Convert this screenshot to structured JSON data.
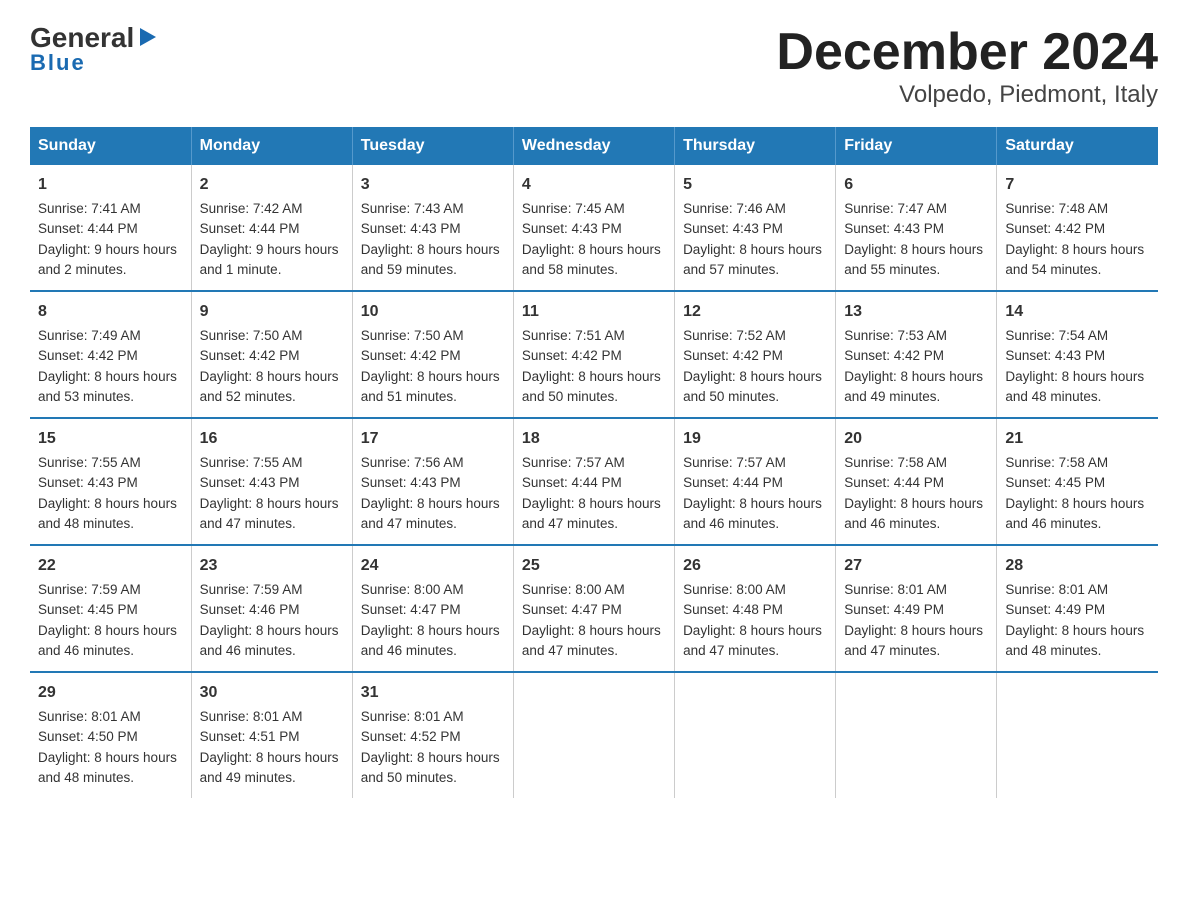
{
  "logo": {
    "general": "General",
    "blue": "Blue",
    "arrow": "▶"
  },
  "title": "December 2024",
  "subtitle": "Volpedo, Piedmont, Italy",
  "days_of_week": [
    "Sunday",
    "Monday",
    "Tuesday",
    "Wednesday",
    "Thursday",
    "Friday",
    "Saturday"
  ],
  "weeks": [
    [
      {
        "day": "1",
        "sunrise": "7:41 AM",
        "sunset": "4:44 PM",
        "daylight": "9 hours and 2 minutes."
      },
      {
        "day": "2",
        "sunrise": "7:42 AM",
        "sunset": "4:44 PM",
        "daylight": "9 hours and 1 minute."
      },
      {
        "day": "3",
        "sunrise": "7:43 AM",
        "sunset": "4:43 PM",
        "daylight": "8 hours and 59 minutes."
      },
      {
        "day": "4",
        "sunrise": "7:45 AM",
        "sunset": "4:43 PM",
        "daylight": "8 hours and 58 minutes."
      },
      {
        "day": "5",
        "sunrise": "7:46 AM",
        "sunset": "4:43 PM",
        "daylight": "8 hours and 57 minutes."
      },
      {
        "day": "6",
        "sunrise": "7:47 AM",
        "sunset": "4:43 PM",
        "daylight": "8 hours and 55 minutes."
      },
      {
        "day": "7",
        "sunrise": "7:48 AM",
        "sunset": "4:42 PM",
        "daylight": "8 hours and 54 minutes."
      }
    ],
    [
      {
        "day": "8",
        "sunrise": "7:49 AM",
        "sunset": "4:42 PM",
        "daylight": "8 hours and 53 minutes."
      },
      {
        "day": "9",
        "sunrise": "7:50 AM",
        "sunset": "4:42 PM",
        "daylight": "8 hours and 52 minutes."
      },
      {
        "day": "10",
        "sunrise": "7:50 AM",
        "sunset": "4:42 PM",
        "daylight": "8 hours and 51 minutes."
      },
      {
        "day": "11",
        "sunrise": "7:51 AM",
        "sunset": "4:42 PM",
        "daylight": "8 hours and 50 minutes."
      },
      {
        "day": "12",
        "sunrise": "7:52 AM",
        "sunset": "4:42 PM",
        "daylight": "8 hours and 50 minutes."
      },
      {
        "day": "13",
        "sunrise": "7:53 AM",
        "sunset": "4:42 PM",
        "daylight": "8 hours and 49 minutes."
      },
      {
        "day": "14",
        "sunrise": "7:54 AM",
        "sunset": "4:43 PM",
        "daylight": "8 hours and 48 minutes."
      }
    ],
    [
      {
        "day": "15",
        "sunrise": "7:55 AM",
        "sunset": "4:43 PM",
        "daylight": "8 hours and 48 minutes."
      },
      {
        "day": "16",
        "sunrise": "7:55 AM",
        "sunset": "4:43 PM",
        "daylight": "8 hours and 47 minutes."
      },
      {
        "day": "17",
        "sunrise": "7:56 AM",
        "sunset": "4:43 PM",
        "daylight": "8 hours and 47 minutes."
      },
      {
        "day": "18",
        "sunrise": "7:57 AM",
        "sunset": "4:44 PM",
        "daylight": "8 hours and 47 minutes."
      },
      {
        "day": "19",
        "sunrise": "7:57 AM",
        "sunset": "4:44 PM",
        "daylight": "8 hours and 46 minutes."
      },
      {
        "day": "20",
        "sunrise": "7:58 AM",
        "sunset": "4:44 PM",
        "daylight": "8 hours and 46 minutes."
      },
      {
        "day": "21",
        "sunrise": "7:58 AM",
        "sunset": "4:45 PM",
        "daylight": "8 hours and 46 minutes."
      }
    ],
    [
      {
        "day": "22",
        "sunrise": "7:59 AM",
        "sunset": "4:45 PM",
        "daylight": "8 hours and 46 minutes."
      },
      {
        "day": "23",
        "sunrise": "7:59 AM",
        "sunset": "4:46 PM",
        "daylight": "8 hours and 46 minutes."
      },
      {
        "day": "24",
        "sunrise": "8:00 AM",
        "sunset": "4:47 PM",
        "daylight": "8 hours and 46 minutes."
      },
      {
        "day": "25",
        "sunrise": "8:00 AM",
        "sunset": "4:47 PM",
        "daylight": "8 hours and 47 minutes."
      },
      {
        "day": "26",
        "sunrise": "8:00 AM",
        "sunset": "4:48 PM",
        "daylight": "8 hours and 47 minutes."
      },
      {
        "day": "27",
        "sunrise": "8:01 AM",
        "sunset": "4:49 PM",
        "daylight": "8 hours and 47 minutes."
      },
      {
        "day": "28",
        "sunrise": "8:01 AM",
        "sunset": "4:49 PM",
        "daylight": "8 hours and 48 minutes."
      }
    ],
    [
      {
        "day": "29",
        "sunrise": "8:01 AM",
        "sunset": "4:50 PM",
        "daylight": "8 hours and 48 minutes."
      },
      {
        "day": "30",
        "sunrise": "8:01 AM",
        "sunset": "4:51 PM",
        "daylight": "8 hours and 49 minutes."
      },
      {
        "day": "31",
        "sunrise": "8:01 AM",
        "sunset": "4:52 PM",
        "daylight": "8 hours and 50 minutes."
      },
      null,
      null,
      null,
      null
    ]
  ]
}
